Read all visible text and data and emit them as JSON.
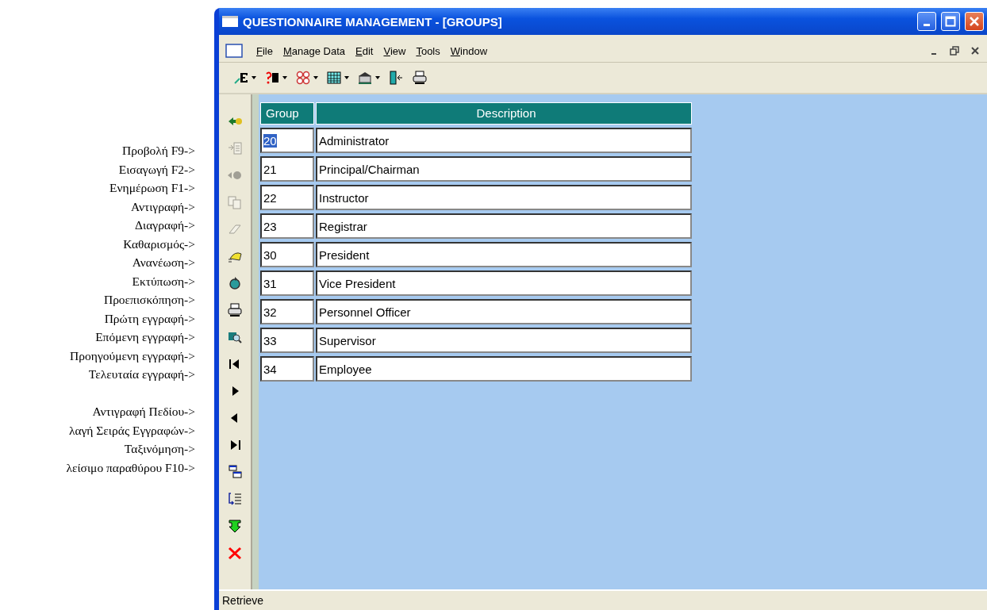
{
  "side_label_groups": [
    [
      "Προβολή F9->",
      "Εισαγωγή F2->",
      "Ενημέρωση F1->",
      "Αντιγραφή->",
      "Διαγραφή->",
      "Καθαρισμός->",
      "Ανανέωση->",
      "Εκτύπωση->",
      "Προεπισκόπηση->",
      "Πρώτη εγγραφή->",
      "Επόμενη εγγραφή->",
      "Προηγούμενη εγγραφή->",
      "Τελευταία εγγραφή->"
    ],
    [
      "Αντιγραφή Πεδίου->",
      "λαγή Σειράς Εγγραφών->",
      "Ταξινόμηση->",
      "λείσιμο παραθύρου F10->"
    ]
  ],
  "window": {
    "title": "QUESTIONNAIRE MANAGEMENT - [GROUPS]"
  },
  "menu": [
    "File",
    "Manage Data",
    "Edit",
    "View",
    "Tools",
    "Window"
  ],
  "vertical_toolbar": [
    {
      "disabled": false
    },
    {
      "disabled": true
    },
    {
      "disabled": true
    },
    {
      "disabled": true
    },
    {
      "disabled": true
    },
    {
      "disabled": false
    },
    {
      "disabled": false
    },
    {
      "disabled": false
    },
    {
      "disabled": false
    },
    {
      "disabled": false
    },
    {
      "disabled": false
    },
    {
      "disabled": false
    },
    {
      "disabled": false
    },
    {
      "disabled": false
    },
    {
      "disabled": false
    },
    {
      "disabled": false
    },
    {
      "disabled": false
    }
  ],
  "table": {
    "columns": [
      "Group",
      "Description"
    ],
    "rows": [
      {
        "group": "20",
        "description": "Administrator",
        "selected": true
      },
      {
        "group": "21",
        "description": "Principal/Chairman",
        "selected": false
      },
      {
        "group": "22",
        "description": "Instructor",
        "selected": false
      },
      {
        "group": "23",
        "description": "Registrar",
        "selected": false
      },
      {
        "group": "30",
        "description": "President",
        "selected": false
      },
      {
        "group": "31",
        "description": "Vice President",
        "selected": false
      },
      {
        "group": "32",
        "description": "Personnel Officer",
        "selected": false
      },
      {
        "group": "33",
        "description": "Supervisor",
        "selected": false
      },
      {
        "group": "34",
        "description": "Employee",
        "selected": false
      }
    ]
  },
  "status_bar": "Retrieve"
}
